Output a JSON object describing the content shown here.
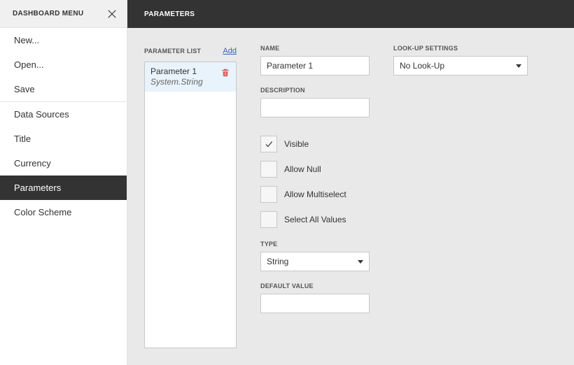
{
  "sidebar": {
    "title": "DASHBOARD MENU",
    "group1": [
      {
        "label": "New..."
      },
      {
        "label": "Open..."
      },
      {
        "label": "Save"
      }
    ],
    "group2": [
      {
        "label": "Data Sources"
      },
      {
        "label": "Title"
      },
      {
        "label": "Currency"
      },
      {
        "label": "Parameters",
        "active": true
      },
      {
        "label": "Color Scheme"
      }
    ]
  },
  "topbar": {
    "title": "PARAMETERS"
  },
  "paramList": {
    "label": "PARAMETER LIST",
    "addLabel": "Add",
    "items": [
      {
        "name": "Parameter 1",
        "type": "System.String"
      }
    ]
  },
  "form": {
    "nameLabel": "NAME",
    "nameValue": "Parameter 1",
    "descriptionLabel": "DESCRIPTION",
    "descriptionValue": "",
    "checkboxes": {
      "visible": {
        "label": "Visible",
        "checked": true
      },
      "allowNull": {
        "label": "Allow Null",
        "checked": false
      },
      "allowMulti": {
        "label": "Allow Multiselect",
        "checked": false
      },
      "selectAll": {
        "label": "Select All Values",
        "checked": false
      }
    },
    "typeLabel": "TYPE",
    "typeValue": "String",
    "defaultLabel": "DEFAULT VALUE",
    "defaultValue": ""
  },
  "lookup": {
    "label": "LOOK-UP SETTINGS",
    "value": "No Look-Up"
  }
}
